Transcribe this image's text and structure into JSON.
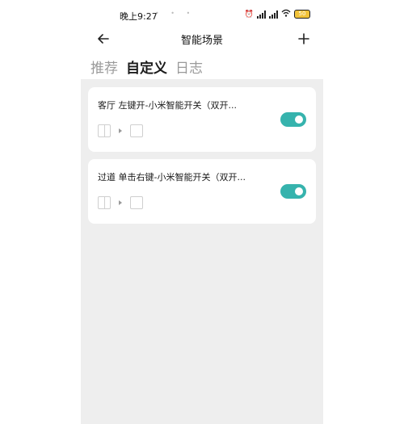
{
  "status_bar": {
    "time": "晚上9:27",
    "dots": "• • •",
    "signal_1_label": "5G",
    "signal_2_label": "5G",
    "battery": "50"
  },
  "header": {
    "title": "智能场景",
    "back_icon": "arrow-left-icon",
    "add_icon": "plus-icon"
  },
  "tabs": [
    {
      "label": "推荐",
      "active": false
    },
    {
      "label": "自定义",
      "active": true
    },
    {
      "label": "日志",
      "active": false
    }
  ],
  "scenes": [
    {
      "title": "客厅 左键开-小米智能开关（双开...",
      "enabled": true
    },
    {
      "title": "过道 单击右键-小米智能开关（双开...",
      "enabled": true
    }
  ],
  "colors": {
    "toggle_on": "#36b3ad",
    "content_bg": "#eeeeee"
  }
}
